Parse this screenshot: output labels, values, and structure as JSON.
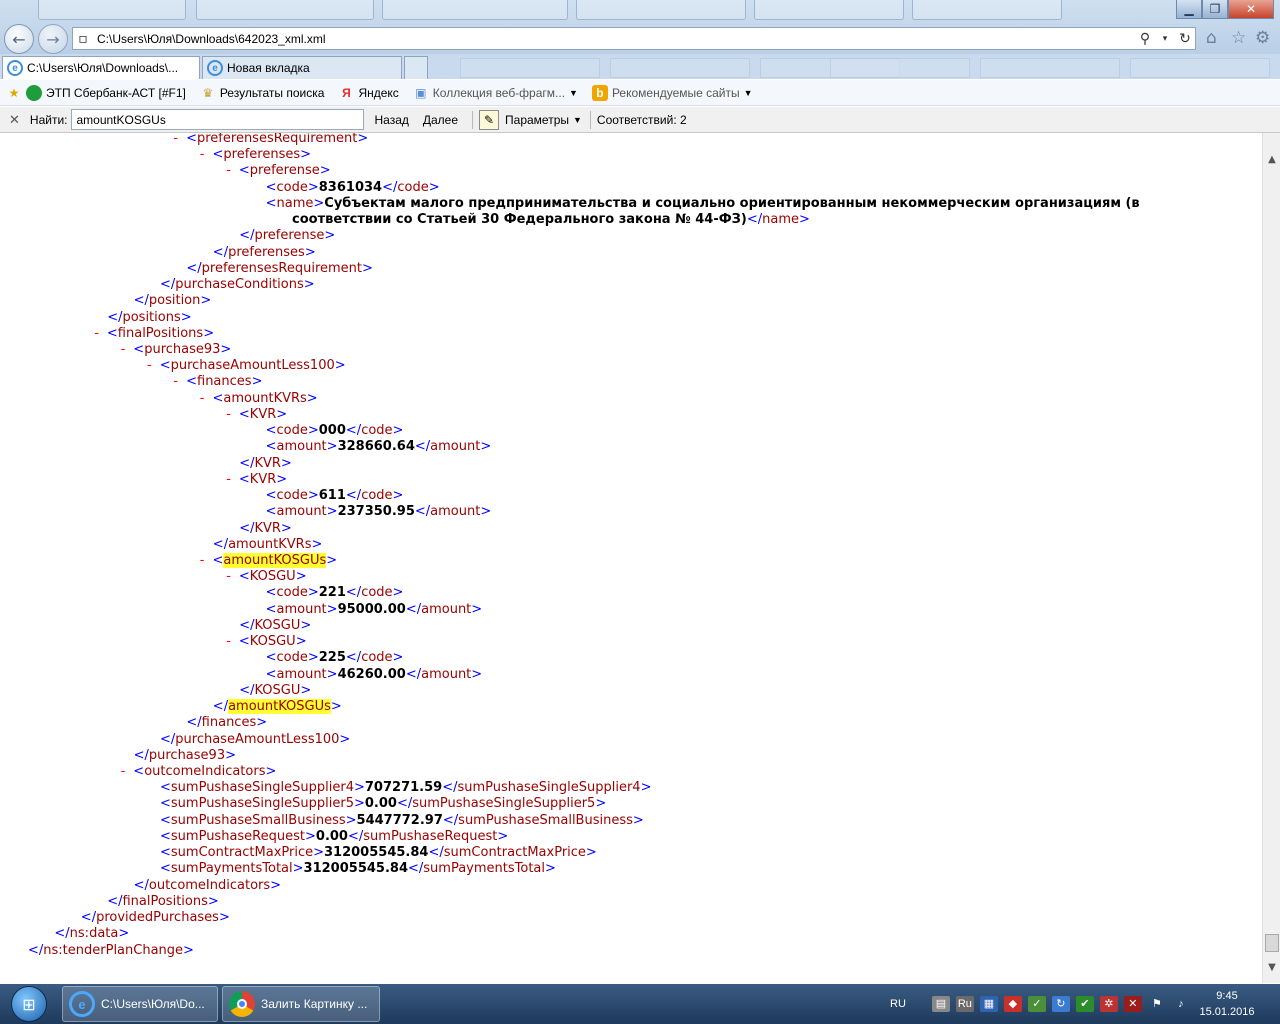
{
  "window": {
    "address": "C:\\Users\\Юля\\Downloads\\642023_xml.xml"
  },
  "tabs": [
    {
      "label": "C:\\Users\\Юля\\Downloads\\...",
      "active": true
    },
    {
      "label": "Новая вкладка",
      "active": false
    }
  ],
  "favorites": [
    {
      "label": "ЭТП Сбербанк-АСТ [#F1]",
      "icon": "sberbank-icon",
      "color": "#1f9d3a"
    },
    {
      "label": "Результаты поиска",
      "icon": "eagle-icon",
      "color": "#c8a23a"
    },
    {
      "label": "Яндекс",
      "icon": "yandex-icon",
      "color": "#e62e2e"
    },
    {
      "label": "Коллекция веб-фрагм...",
      "icon": "webslice-icon",
      "color": "#5c8fd6"
    },
    {
      "label": "Рекомендуемые сайты",
      "icon": "bing-icon",
      "color": "#f0a500"
    }
  ],
  "findbar": {
    "label": "Найти:",
    "query": "amountKOSGUs",
    "back": "Назад",
    "next": "Далее",
    "options": "Параметры",
    "matches": "Соответствий: 2"
  },
  "xml": [
    {
      "i": 6,
      "m": "-",
      "p": "<",
      "t": "preferensesRequirement",
      "s": ">",
      "bold": false
    },
    {
      "i": 7,
      "m": "-",
      "p": "<",
      "t": "preferenses",
      "s": ">"
    },
    {
      "i": 8,
      "m": "-",
      "p": "<",
      "t": "preferense",
      "s": ">"
    },
    {
      "i": 9,
      "m": "",
      "p": "<",
      "t": "code",
      "s": ">",
      "v": "8361034",
      "ct": "code"
    },
    {
      "i": 9,
      "m": "",
      "p": "<",
      "t": "name",
      "s": ">",
      "v": "Субъектам малого предпринимательства и социально ориентированным некоммерческим организациям (в",
      "ct": ""
    },
    {
      "i": 10,
      "m": "",
      "p": "",
      "t": "",
      "s": "",
      "v": "соответствии со Статьей 30 Федерального закона № 44-ФЗ)",
      "ct": "name",
      "cont": true
    },
    {
      "i": 8,
      "m": "",
      "p": "</",
      "t": "preferense",
      "s": ">"
    },
    {
      "i": 7,
      "m": "",
      "p": "</",
      "t": "preferenses",
      "s": ">"
    },
    {
      "i": 6,
      "m": "",
      "p": "</",
      "t": "preferensesRequirement",
      "s": ">"
    },
    {
      "i": 5,
      "m": "",
      "p": "</",
      "t": "purchaseConditions",
      "s": ">"
    },
    {
      "i": 4,
      "m": "",
      "p": "</",
      "t": "position",
      "s": ">"
    },
    {
      "i": 3,
      "m": "",
      "p": "</",
      "t": "positions",
      "s": ">"
    },
    {
      "i": 3,
      "m": "-",
      "p": "<",
      "t": "finalPositions",
      "s": ">"
    },
    {
      "i": 4,
      "m": "-",
      "p": "<",
      "t": "purchase93",
      "s": ">"
    },
    {
      "i": 5,
      "m": "-",
      "p": "<",
      "t": "purchaseAmountLess100",
      "s": ">"
    },
    {
      "i": 6,
      "m": "-",
      "p": "<",
      "t": "finances",
      "s": ">"
    },
    {
      "i": 7,
      "m": "-",
      "p": "<",
      "t": "amountKVRs",
      "s": ">"
    },
    {
      "i": 8,
      "m": "-",
      "p": "<",
      "t": "KVR",
      "s": ">"
    },
    {
      "i": 9,
      "m": "",
      "p": "<",
      "t": "code",
      "s": ">",
      "v": "000",
      "ct": "code"
    },
    {
      "i": 9,
      "m": "",
      "p": "<",
      "t": "amount",
      "s": ">",
      "v": "328660.64",
      "ct": "amount"
    },
    {
      "i": 8,
      "m": "",
      "p": "</",
      "t": "KVR",
      "s": ">"
    },
    {
      "i": 8,
      "m": "-",
      "p": "<",
      "t": "KVR",
      "s": ">"
    },
    {
      "i": 9,
      "m": "",
      "p": "<",
      "t": "code",
      "s": ">",
      "v": "611",
      "ct": "code"
    },
    {
      "i": 9,
      "m": "",
      "p": "<",
      "t": "amount",
      "s": ">",
      "v": "237350.95",
      "ct": "amount"
    },
    {
      "i": 8,
      "m": "",
      "p": "</",
      "t": "KVR",
      "s": ">"
    },
    {
      "i": 7,
      "m": "",
      "p": "</",
      "t": "amountKVRs",
      "s": ">"
    },
    {
      "i": 7,
      "m": "-",
      "p": "<",
      "t": "amountKOSGUs",
      "s": ">",
      "hl": true
    },
    {
      "i": 8,
      "m": "-",
      "p": "<",
      "t": "KOSGU",
      "s": ">"
    },
    {
      "i": 9,
      "m": "",
      "p": "<",
      "t": "code",
      "s": ">",
      "v": "221",
      "ct": "code"
    },
    {
      "i": 9,
      "m": "",
      "p": "<",
      "t": "amount",
      "s": ">",
      "v": "95000.00",
      "ct": "amount"
    },
    {
      "i": 8,
      "m": "",
      "p": "</",
      "t": "KOSGU",
      "s": ">"
    },
    {
      "i": 8,
      "m": "-",
      "p": "<",
      "t": "KOSGU",
      "s": ">"
    },
    {
      "i": 9,
      "m": "",
      "p": "<",
      "t": "code",
      "s": ">",
      "v": "225",
      "ct": "code"
    },
    {
      "i": 9,
      "m": "",
      "p": "<",
      "t": "amount",
      "s": ">",
      "v": "46260.00",
      "ct": "amount"
    },
    {
      "i": 8,
      "m": "",
      "p": "</",
      "t": "KOSGU",
      "s": ">"
    },
    {
      "i": 7,
      "m": "",
      "p": "</",
      "t": "amountKOSGUs",
      "s": ">",
      "hl": true
    },
    {
      "i": 6,
      "m": "",
      "p": "</",
      "t": "finances",
      "s": ">"
    },
    {
      "i": 5,
      "m": "",
      "p": "</",
      "t": "purchaseAmountLess100",
      "s": ">"
    },
    {
      "i": 4,
      "m": "",
      "p": "</",
      "t": "purchase93",
      "s": ">"
    },
    {
      "i": 4,
      "m": "-",
      "p": "<",
      "t": "outcomeIndicators",
      "s": ">"
    },
    {
      "i": 5,
      "m": "",
      "p": "<",
      "t": "sumPushaseSingleSupplier4",
      "s": ">",
      "v": "707271.59",
      "ct": "sumPushaseSingleSupplier4"
    },
    {
      "i": 5,
      "m": "",
      "p": "<",
      "t": "sumPushaseSingleSupplier5",
      "s": ">",
      "v": "0.00",
      "ct": "sumPushaseSingleSupplier5"
    },
    {
      "i": 5,
      "m": "",
      "p": "<",
      "t": "sumPushaseSmallBusiness",
      "s": ">",
      "v": "5447772.97",
      "ct": "sumPushaseSmallBusiness"
    },
    {
      "i": 5,
      "m": "",
      "p": "<",
      "t": "sumPushaseRequest",
      "s": ">",
      "v": "0.00",
      "ct": "sumPushaseRequest"
    },
    {
      "i": 5,
      "m": "",
      "p": "<",
      "t": "sumContractMaxPrice",
      "s": ">",
      "v": "312005545.84",
      "ct": "sumContractMaxPrice"
    },
    {
      "i": 5,
      "m": "",
      "p": "<",
      "t": "sumPaymentsTotal",
      "s": ">",
      "v": "312005545.84",
      "ct": "sumPaymentsTotal"
    },
    {
      "i": 4,
      "m": "",
      "p": "</",
      "t": "outcomeIndicators",
      "s": ">"
    },
    {
      "i": 3,
      "m": "",
      "p": "</",
      "t": "finalPositions",
      "s": ">"
    },
    {
      "i": 2,
      "m": "",
      "p": "</",
      "t": "providedPurchases",
      "s": ">"
    },
    {
      "i": 1,
      "m": "",
      "p": "</",
      "t": "ns:data",
      "s": ">"
    },
    {
      "i": 0,
      "m": "",
      "p": "</",
      "t": "ns:tenderPlanChange",
      "s": ">"
    }
  ],
  "taskbar": {
    "items": [
      {
        "label": "C:\\Users\\Юля\\Do...",
        "icon": "ie-icon"
      },
      {
        "label": "Залить Картинку ...",
        "icon": "chrome-icon"
      }
    ],
    "lang": "RU",
    "time": "9:45",
    "date": "15.01.2016"
  }
}
